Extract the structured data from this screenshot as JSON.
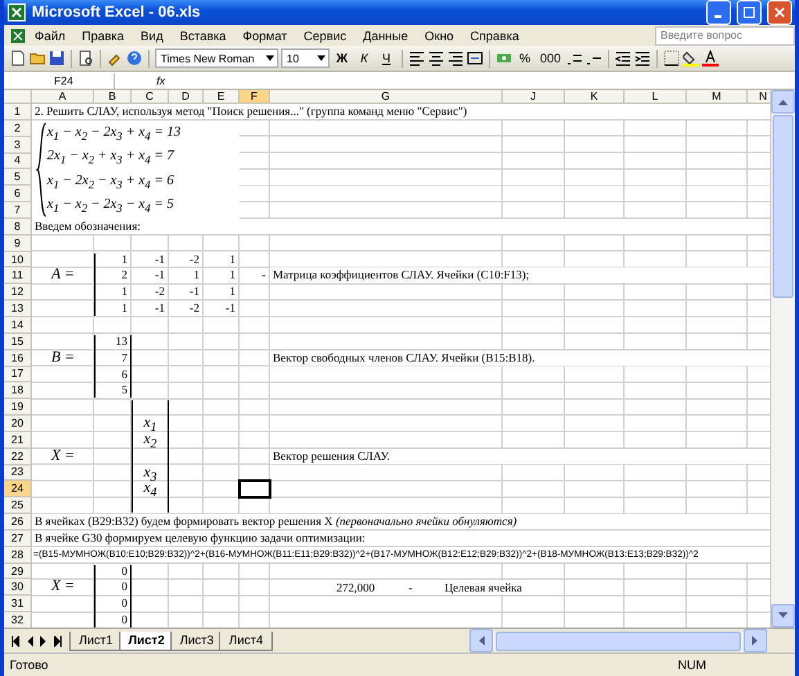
{
  "window": {
    "title": "Microsoft Excel - 06.xls"
  },
  "menu": [
    "Файл",
    "Правка",
    "Вид",
    "Вставка",
    "Формат",
    "Сервис",
    "Данные",
    "Окно",
    "Справка"
  ],
  "help": {
    "placeholder": "Введите вопрос"
  },
  "toolbar": {
    "font": "Times New Roman",
    "size": "10",
    "style_buttons": [
      "Ж",
      "К",
      "Ч"
    ],
    "number_buttons": [
      "%",
      "000"
    ]
  },
  "formula_bar": {
    "name_box": "F24",
    "function_label": "fx"
  },
  "columns": [
    {
      "label": "A",
      "selected": false
    },
    {
      "label": "B",
      "selected": false
    },
    {
      "label": "C",
      "selected": false
    },
    {
      "label": "D",
      "selected": false
    },
    {
      "label": "E",
      "selected": false
    },
    {
      "label": "F",
      "selected": true
    },
    {
      "label": "G",
      "selected": false
    },
    {
      "label": "J",
      "selected": false
    },
    {
      "label": "K",
      "selected": false
    },
    {
      "label": "L",
      "selected": false
    },
    {
      "label": "M",
      "selected": false
    },
    {
      "label": "N",
      "selected": false
    }
  ],
  "equation_system": {
    "lines": [
      "x$_{1}$ − x$_{2}$ − 2x$_{3}$ + x$_{4}$ = 13",
      "2x$_{1}$ − x$_{2}$ + x$_{3}$ + x$_{4}$ = 7",
      "x$_{1}$ − 2x$_{2}$ − x$_{3}$ + x$_{4}$ = 6",
      "x$_{1}$ − x$_{2}$ − 2x$_{3}$ − x$_{4}$ = 5"
    ]
  },
  "rows": [
    {
      "number": "1",
      "selected": false,
      "A": {
        "kind": "text",
        "text": "2. Решить СЛАУ, используя метод \"Поиск решения...\" (группа команд меню \"Сервис\")"
      }
    },
    {
      "number": "2",
      "selected": false
    },
    {
      "number": "3",
      "selected": false
    },
    {
      "number": "4",
      "selected": false
    },
    {
      "number": "5",
      "selected": false
    },
    {
      "number": "6",
      "selected": false
    },
    {
      "number": "7",
      "selected": false
    },
    {
      "number": "8",
      "selected": false,
      "A": {
        "kind": "text",
        "text": "Введем обозначения:"
      }
    },
    {
      "number": "9",
      "selected": false
    },
    {
      "number": "10",
      "selected": false,
      "B": {
        "kind": "number",
        "text": "1"
      },
      "C": {
        "kind": "number",
        "text": "-1"
      },
      "D": {
        "kind": "number",
        "text": "-2"
      },
      "E": {
        "kind": "number",
        "text": "1"
      }
    },
    {
      "number": "11",
      "selected": false,
      "A": {
        "kind": "math",
        "text": "A ="
      },
      "B": {
        "kind": "number",
        "text": "2"
      },
      "C": {
        "kind": "number",
        "text": "-1"
      },
      "D": {
        "kind": "number",
        "text": "1"
      },
      "E": {
        "kind": "number",
        "text": "1"
      },
      "F": {
        "kind": "number",
        "text": "-"
      },
      "G": {
        "kind": "text",
        "text": "Матрица коэффициентов СЛАУ. Ячейки (C10:F13);"
      }
    },
    {
      "number": "12",
      "selected": false,
      "B": {
        "kind": "number",
        "text": "1"
      },
      "C": {
        "kind": "number",
        "text": "-2"
      },
      "D": {
        "kind": "number",
        "text": "-1"
      },
      "E": {
        "kind": "number",
        "text": "1"
      }
    },
    {
      "number": "13",
      "selected": false,
      "B": {
        "kind": "number",
        "text": "1"
      },
      "C": {
        "kind": "number",
        "text": "-1"
      },
      "D": {
        "kind": "number",
        "text": "-2"
      },
      "E": {
        "kind": "number",
        "text": "-1"
      }
    },
    {
      "number": "14",
      "selected": false
    },
    {
      "number": "15",
      "selected": false,
      "B": {
        "kind": "number",
        "text": "13"
      }
    },
    {
      "number": "16",
      "selected": false,
      "A": {
        "kind": "math",
        "text": "B ="
      },
      "B": {
        "kind": "number",
        "text": "7"
      },
      "G": {
        "kind": "text",
        "text": "Вектор свободных членов СЛАУ. Ячейки (B15:B18)."
      }
    },
    {
      "number": "17",
      "selected": false,
      "B": {
        "kind": "number",
        "text": "6"
      }
    },
    {
      "number": "18",
      "selected": false,
      "B": {
        "kind": "number",
        "text": "5"
      }
    },
    {
      "number": "19",
      "selected": false
    },
    {
      "number": "20",
      "selected": false,
      "C": {
        "kind": "math",
        "text": "x$_{1}$"
      }
    },
    {
      "number": "21",
      "selected": false,
      "C": {
        "kind": "math",
        "text": "x$_{2}$"
      }
    },
    {
      "number": "22",
      "selected": false,
      "A": {
        "kind": "math",
        "text": "X ="
      },
      "G": {
        "kind": "text",
        "text": "Вектор решения СЛАУ."
      }
    },
    {
      "number": "23",
      "selected": false,
      "C": {
        "kind": "math",
        "text": "x$_{3}$"
      }
    },
    {
      "number": "24",
      "selected": true,
      "C": {
        "kind": "math",
        "text": "x$_{4}$"
      }
    },
    {
      "number": "25",
      "selected": false
    },
    {
      "number": "26",
      "selected": false,
      "A": {
        "kind": "text",
        "text": "В ячейках (B29:B32) будем формировать вектор решения X *(первоначально ячейки обнуляются)*"
      }
    },
    {
      "number": "27",
      "selected": false,
      "A": {
        "kind": "text",
        "text": "В ячейке G30 формируем целевую функцию задачи оптимизации:"
      }
    },
    {
      "number": "28",
      "selected": false,
      "A": {
        "kind": "formula",
        "text": "=(B15-МУМНОЖ(B10:E10;B29:B32))^2+(B16-МУМНОЖ(B11:E11;B29:B32))^2+(B17-МУМНОЖ(B12:E12;B29:B32))^2+(B18-МУМНОЖ(B13:E13;B29:B32))^2"
      }
    },
    {
      "number": "29",
      "selected": false,
      "B": {
        "kind": "number",
        "text": "0"
      }
    },
    {
      "number": "30",
      "selected": false,
      "A": {
        "kind": "math",
        "text": "X ="
      },
      "B": {
        "kind": "number",
        "text": "0"
      },
      "G": {
        "kind": "result",
        "parts": [
          "272,000",
          "-",
          "Целевая ячейка"
        ]
      }
    },
    {
      "number": "31",
      "selected": false,
      "B": {
        "kind": "number",
        "text": "0"
      }
    },
    {
      "number": "32",
      "selected": false,
      "B": {
        "kind": "number",
        "text": "0"
      }
    }
  ],
  "sheet_tabs": [
    {
      "label": "Лист1",
      "selected": false
    },
    {
      "label": "Лист2",
      "selected": true
    },
    {
      "label": "Лист3",
      "selected": false
    },
    {
      "label": "Лист4",
      "selected": false
    }
  ],
  "status_bar": {
    "state": "Готово",
    "mode": "NUM"
  }
}
